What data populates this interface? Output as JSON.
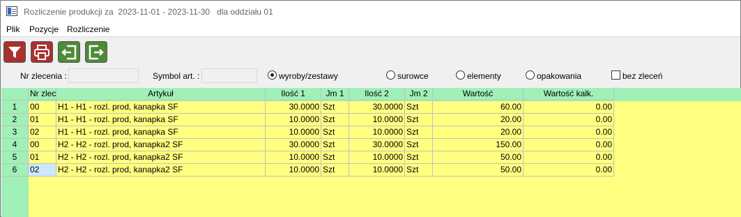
{
  "window": {
    "title": "Rozliczenie produkcji za  2023-11-01 - 2023-11-30   dla oddziału 01"
  },
  "menu": [
    "Plik",
    "Pozycje",
    "Rozliczenie"
  ],
  "toolbar": {
    "buttons": [
      {
        "name": "filter",
        "icon": "funnel-icon",
        "color": "#a8322e"
      },
      {
        "name": "print",
        "icon": "printer-icon",
        "color": "#a8322e"
      },
      {
        "name": "prev",
        "icon": "exit-left-icon",
        "color": "#4f8a37"
      },
      {
        "name": "next",
        "icon": "exit-right-icon",
        "color": "#4f8a37"
      }
    ]
  },
  "filters": {
    "nr_zlecenia_label": "Nr zlecenia :",
    "nr_zlecenia_value": "",
    "symbol_label": "Symbol art. :",
    "symbol_value": "",
    "radios": [
      {
        "label": "wyroby/zestawy",
        "checked": true
      },
      {
        "label": "surowce",
        "checked": false
      },
      {
        "label": "elementy",
        "checked": false
      },
      {
        "label": "opakowania",
        "checked": false
      }
    ],
    "bez_zlecen_label": "bez zleceń",
    "bez_zlecen_checked": false
  },
  "table": {
    "columns": [
      "Nr zlec",
      "Artykuł",
      "Ilość 1",
      "Jm 1",
      "Ilość 2",
      "Jm 2",
      "Wartość",
      "Wartość kalk."
    ],
    "rows": [
      {
        "n": "1",
        "cells": [
          "00",
          "H1 - H1 - rozl. prod, kanapka SF",
          "30.0000",
          "Szt",
          "30.0000",
          "Szt",
          "60.00",
          "0.00"
        ]
      },
      {
        "n": "2",
        "cells": [
          "01",
          "H1 - H1 - rozl. prod, kanapka SF",
          "10.0000",
          "Szt",
          "10.0000",
          "Szt",
          "20.00",
          "0.00"
        ]
      },
      {
        "n": "3",
        "cells": [
          "02",
          "H1 - H1 - rozl. prod, kanapka SF",
          "10.0000",
          "Szt",
          "10.0000",
          "Szt",
          "20.00",
          "0.00"
        ]
      },
      {
        "n": "4",
        "cells": [
          "00",
          "H2 - H2 - rozl. prod, kanapka2 SF",
          "30.0000",
          "Szt",
          "30.0000",
          "Szt",
          "150.00",
          "0.00"
        ]
      },
      {
        "n": "5",
        "cells": [
          "01",
          "H2 - H2 - rozl. prod, kanapka2 SF",
          "10.0000",
          "Szt",
          "10.0000",
          "Szt",
          "50.00",
          "0.00"
        ]
      },
      {
        "n": "6",
        "cells": [
          "02",
          "H2 - H2 - rozl. prod, kanapka2 SF",
          "10.0000",
          "Szt",
          "10.0000",
          "Szt",
          "50.00",
          "0.00"
        ]
      }
    ],
    "selected_row": 5,
    "colors": {
      "header": "#a0f0b8",
      "body": "#ffff80",
      "selected": "#cce8ff"
    }
  }
}
